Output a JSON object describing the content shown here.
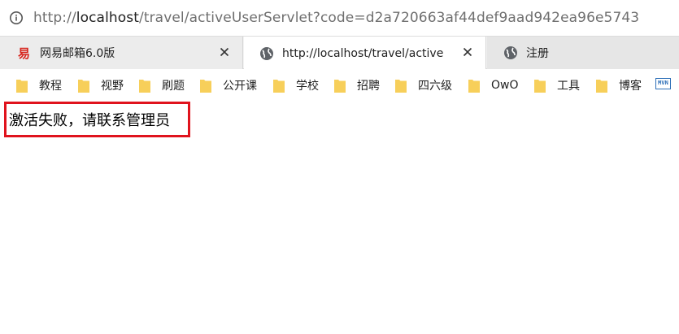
{
  "address_bar": {
    "url_prefix": "http://",
    "url_host": "localhost",
    "url_rest": "/travel/activeUserServlet?code=d2a720663af44def9aad942ea96e5743"
  },
  "tabs": [
    {
      "title": "网易邮箱6.0版",
      "icon": "netease-mail-icon",
      "active": false
    },
    {
      "title": "http://localhost/travel/active",
      "icon": "globe-icon",
      "active": true
    },
    {
      "title": "注册",
      "icon": "globe-icon",
      "active": false
    }
  ],
  "bookmarks": [
    {
      "label": "教程"
    },
    {
      "label": "视野"
    },
    {
      "label": "刷题"
    },
    {
      "label": "公开课"
    },
    {
      "label": "学校"
    },
    {
      "label": "招聘"
    },
    {
      "label": "四六级"
    },
    {
      "label": "OwO"
    },
    {
      "label": "工具"
    },
    {
      "label": "博客"
    }
  ],
  "bookmark_extra": {
    "icon": "mvn-icon",
    "text": "MVN"
  },
  "page": {
    "message": "激活失败，请联系管理员"
  },
  "colors": {
    "highlight_border": "#e0131d",
    "folder": "#f7cf5a",
    "netease_red": "#d7261e"
  }
}
